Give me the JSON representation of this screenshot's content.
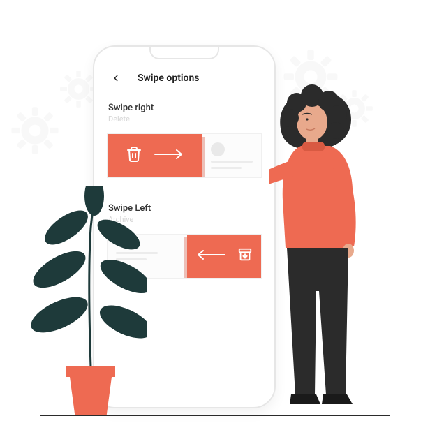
{
  "colors": {
    "accent": "#EE6A52",
    "muted": "#D6D6D6",
    "dark": "#222222"
  },
  "header": {
    "title": "Swipe options",
    "back_icon": "chevron-left"
  },
  "sections": [
    {
      "title": "Swipe right",
      "subtitle": "Delete",
      "action_icon": "trash",
      "direction": "right"
    },
    {
      "title": "Swipe Left",
      "subtitle": "Archive",
      "action_icon": "archive",
      "direction": "left"
    }
  ]
}
